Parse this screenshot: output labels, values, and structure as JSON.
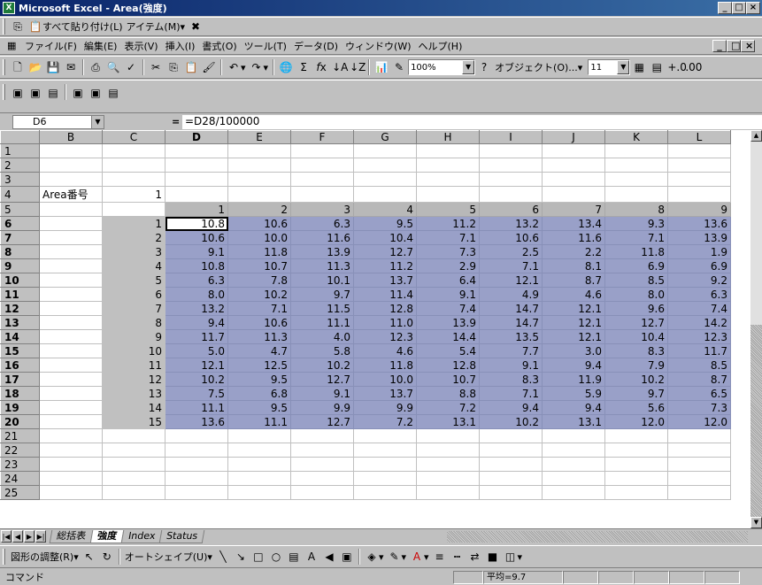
{
  "window": {
    "title": "Microsoft Excel - Area(強度)"
  },
  "toolbar_top": {
    "paste_all": "すべて貼り付け(L)",
    "items": "アイテム(M)"
  },
  "menu": [
    "ファイル(F)",
    "編集(E)",
    "表示(V)",
    "挿入(I)",
    "書式(O)",
    "ツール(T)",
    "データ(D)",
    "ウィンドウ(W)",
    "ヘルプ(H)"
  ],
  "standard": {
    "zoom": "100%",
    "object_label": "オブジェクト(O)...",
    "font_size": "11"
  },
  "formula_bar": {
    "name_box": "D6",
    "eq": "=",
    "formula": "=D28/100000"
  },
  "columns": [
    "B",
    "C",
    "D",
    "E",
    "F",
    "G",
    "H",
    "I",
    "J",
    "K",
    "L"
  ],
  "sheet": {
    "label": "Area番号",
    "area_value": "1",
    "header_row": [
      "1",
      "2",
      "3",
      "4",
      "5",
      "6",
      "7",
      "8",
      "9"
    ],
    "row_numbers": [
      "1",
      "2",
      "3",
      "4",
      "5",
      "6",
      "7",
      "8",
      "9",
      "10",
      "11",
      "12",
      "13",
      "14",
      "15"
    ],
    "rows": [
      [
        "10.8",
        "10.6",
        "6.3",
        "9.5",
        "11.2",
        "13.2",
        "13.4",
        "9.3",
        "13.6"
      ],
      [
        "10.6",
        "10.0",
        "11.6",
        "10.4",
        "7.1",
        "10.6",
        "11.6",
        "7.1",
        "13.9"
      ],
      [
        "9.1",
        "11.8",
        "13.9",
        "12.7",
        "7.3",
        "2.5",
        "2.2",
        "11.8",
        "1.9"
      ],
      [
        "10.8",
        "10.7",
        "11.3",
        "11.2",
        "2.9",
        "7.1",
        "8.1",
        "6.9",
        "6.9"
      ],
      [
        "6.3",
        "7.8",
        "10.1",
        "13.7",
        "6.4",
        "12.1",
        "8.7",
        "8.5",
        "9.2"
      ],
      [
        "8.0",
        "10.2",
        "9.7",
        "11.4",
        "9.1",
        "4.9",
        "4.6",
        "8.0",
        "6.3"
      ],
      [
        "13.2",
        "7.1",
        "11.5",
        "12.8",
        "7.4",
        "14.7",
        "12.1",
        "9.6",
        "7.4"
      ],
      [
        "9.4",
        "10.6",
        "11.1",
        "11.0",
        "13.9",
        "14.7",
        "12.1",
        "12.7",
        "14.2"
      ],
      [
        "11.7",
        "11.3",
        "4.0",
        "12.3",
        "14.4",
        "13.5",
        "12.1",
        "10.4",
        "12.3"
      ],
      [
        "5.0",
        "4.7",
        "5.8",
        "4.6",
        "5.4",
        "7.7",
        "3.0",
        "8.3",
        "11.7"
      ],
      [
        "12.1",
        "12.5",
        "10.2",
        "11.8",
        "12.8",
        "9.1",
        "9.4",
        "7.9",
        "8.5"
      ],
      [
        "10.2",
        "9.5",
        "12.7",
        "10.0",
        "10.7",
        "8.3",
        "11.9",
        "10.2",
        "8.7"
      ],
      [
        "7.5",
        "6.8",
        "9.1",
        "13.7",
        "8.8",
        "7.1",
        "5.9",
        "9.7",
        "6.5"
      ],
      [
        "11.1",
        "9.5",
        "9.9",
        "9.9",
        "7.2",
        "9.4",
        "9.4",
        "5.6",
        "7.3"
      ],
      [
        "13.6",
        "11.1",
        "12.7",
        "7.2",
        "13.1",
        "10.2",
        "13.1",
        "12.0",
        "12.0"
      ]
    ]
  },
  "row_headers": [
    "1",
    "2",
    "3",
    "4",
    "5",
    "6",
    "7",
    "8",
    "9",
    "10",
    "11",
    "12",
    "13",
    "14",
    "15",
    "16",
    "17",
    "18",
    "19",
    "20",
    "21",
    "22",
    "23",
    "24",
    "25"
  ],
  "tabs": [
    "総括表",
    "強度",
    "Index",
    "Status"
  ],
  "drawing": {
    "adjust": "図形の調整(R)",
    "autoshape": "オートシェイプ(U)"
  },
  "status": {
    "mode": "コマンド",
    "average": "平均=9.7"
  }
}
